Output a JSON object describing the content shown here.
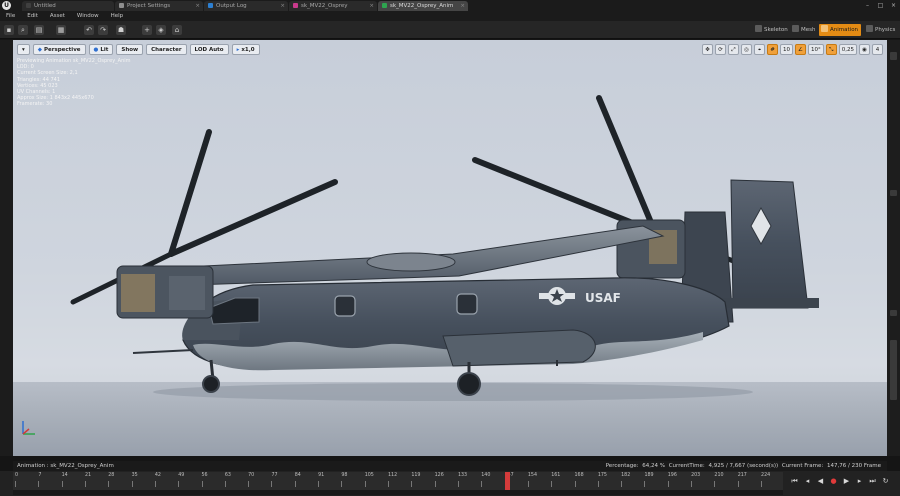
{
  "tabs": [
    {
      "label": "Untitled",
      "dot": "#3f3f3f"
    },
    {
      "label": "Project Settings",
      "dot": "#8f8f8f"
    },
    {
      "label": "Output Log",
      "dot": "#2c7fd1"
    },
    {
      "label": "sk_MV22_Osprey",
      "dot": "#c93a8c"
    },
    {
      "label": "sk_MV22_Osprey_Anim",
      "dot": "#2ea44f"
    }
  ],
  "menu": [
    "File",
    "Edit",
    "Asset",
    "Window",
    "Help"
  ],
  "modes": [
    {
      "label": "Skeleton",
      "active": false
    },
    {
      "label": "Mesh",
      "active": false
    },
    {
      "label": "Animation",
      "active": true
    },
    {
      "label": "Physics",
      "active": false
    }
  ],
  "viewport_toolbar": {
    "perspective": "Perspective",
    "lit": "Lit",
    "show": "Show",
    "character": "Character",
    "lod": "LOD Auto",
    "speed": "x1,0"
  },
  "viewport_right": {
    "grid": "10",
    "rotation": "10°",
    "scale": "0,25",
    "camera": "4"
  },
  "stats": [
    "Previewing Animation sk_MV22_Osprey_Anim",
    "LOD: 0",
    "Current Screen Size: 2,1",
    "Triangles: 44 741",
    "Vertices: 45 023",
    "UV Channels: 1",
    "Approx Size: 1 843x2 445x670",
    "Framerate: 30"
  ],
  "status": {
    "animation": "Animation : sk_MV22_Osprey_Anim",
    "percentage_label": "Percentage:",
    "percentage": "64,24 %",
    "current_time_label": "CurrentTime:",
    "current_time": "4,925 / 7,667 (second(s))",
    "current_frame_label": "Current Frame:",
    "current_frame": "147,76 / 230 Frame"
  },
  "timeline": {
    "ticks": [
      "0",
      "7",
      "14",
      "21",
      "28",
      "35",
      "42",
      "49",
      "56",
      "63",
      "70",
      "77",
      "84",
      "91",
      "98",
      "105",
      "112",
      "119",
      "126",
      "133",
      "140",
      "147",
      "154",
      "161",
      "168",
      "175",
      "182",
      "189",
      "196",
      "203",
      "210",
      "217",
      "224"
    ],
    "max_frame": 230,
    "current_frame": 147.76
  },
  "colors": {
    "accent": "#e38b14",
    "scrubber": "#d43b3b",
    "sky": "#cfd5de",
    "floor": "#aab1bb"
  },
  "icons": {
    "play_controls": [
      "skip-start-icon",
      "step-back-icon",
      "reverse-icon",
      "record-icon",
      "play-icon",
      "step-forward-icon",
      "skip-end-icon",
      "loop-icon"
    ]
  }
}
